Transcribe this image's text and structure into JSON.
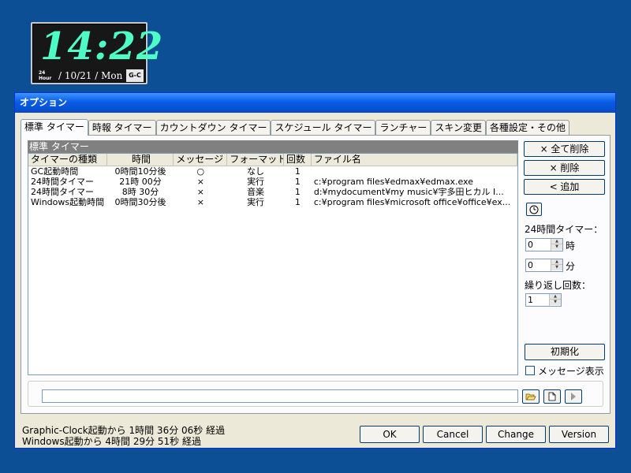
{
  "clock": {
    "time": "14:22",
    "hour_badge_top": "24",
    "hour_badge_bottom": "Hour",
    "date": "/ 10/21 / Mon",
    "brand": "G-C"
  },
  "window": {
    "title": "オプション"
  },
  "tabs": [
    {
      "label": "標準 タイマー",
      "active": true
    },
    {
      "label": "時報 タイマー"
    },
    {
      "label": "カウントダウン タイマー"
    },
    {
      "label": "スケジュール タイマー"
    },
    {
      "label": "ランチャー"
    },
    {
      "label": "スキン変更"
    },
    {
      "label": "各種設定・その他"
    }
  ],
  "timer_group": {
    "title": "標準 タイマー",
    "columns": [
      "タイマーの種類",
      "時間",
      "メッセージ",
      "フォーマット",
      "回数",
      "ファイル名"
    ],
    "rows": [
      [
        "GC起動時間",
        "0時間10分後",
        "○",
        "なし",
        "1",
        ""
      ],
      [
        "24時間タイマー",
        "21時 00分",
        "×",
        "実行",
        "1",
        "c:¥program files¥edmax¥edmax.exe"
      ],
      [
        "24時間タイマー",
        "8時 30分",
        "×",
        "音楽",
        "1",
        "d:¥mydocument¥my music¥宇多田ヒカル I..."
      ],
      [
        "Windows起動時間",
        "0時間30分後",
        "×",
        "実行",
        "1",
        "c:¥program files¥microsoft office¥office¥ex..."
      ]
    ]
  },
  "actions": {
    "delete_all": "× 全て削除",
    "delete": "× 削除",
    "add": "< 追加"
  },
  "timer_settings": {
    "clock_icon": "clock-icon",
    "label_24h": "24時間タイマー：",
    "hour_value": "0",
    "hour_unit": "時",
    "minute_value": "0",
    "minute_unit": "分",
    "repeat_label": "繰り返し回数：",
    "repeat_value": "1",
    "reset_label": "初期化",
    "show_message_label": "メッセージ表示"
  },
  "file_path": {
    "value": ""
  },
  "status": {
    "line1": "Graphic-Clock起動から 1時間 36分 06秒 経過",
    "line2": "Windows起動から 4時間 29分 51秒 経過"
  },
  "dialog_buttons": {
    "ok": "OK",
    "cancel": "Cancel",
    "change": "Change",
    "version": "Version"
  },
  "colors": {
    "desktop": "#0d4f95",
    "clock_digits": "#4dffc5",
    "titlebar": "#0a5ce7"
  }
}
